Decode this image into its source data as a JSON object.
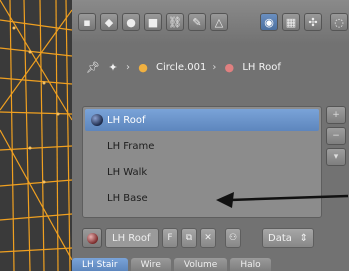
{
  "breadcrumb": {
    "object": "Circle.001",
    "material": "LH Roof"
  },
  "material_slots": [
    {
      "label": "LH Roof",
      "selected": true
    },
    {
      "label": "LH Frame",
      "selected": false
    },
    {
      "label": "LH Walk",
      "selected": false
    },
    {
      "label": "LH Base",
      "selected": false
    }
  ],
  "material_row": {
    "name": "LH Roof",
    "fake_user": "F",
    "data_label": "Data"
  },
  "tabs": [
    "LH Stair",
    "Wire",
    "Volume",
    "Halo"
  ],
  "colors": {
    "selection": "#5d86bd",
    "wireframe": "#f0a020",
    "panel": "#727272"
  }
}
